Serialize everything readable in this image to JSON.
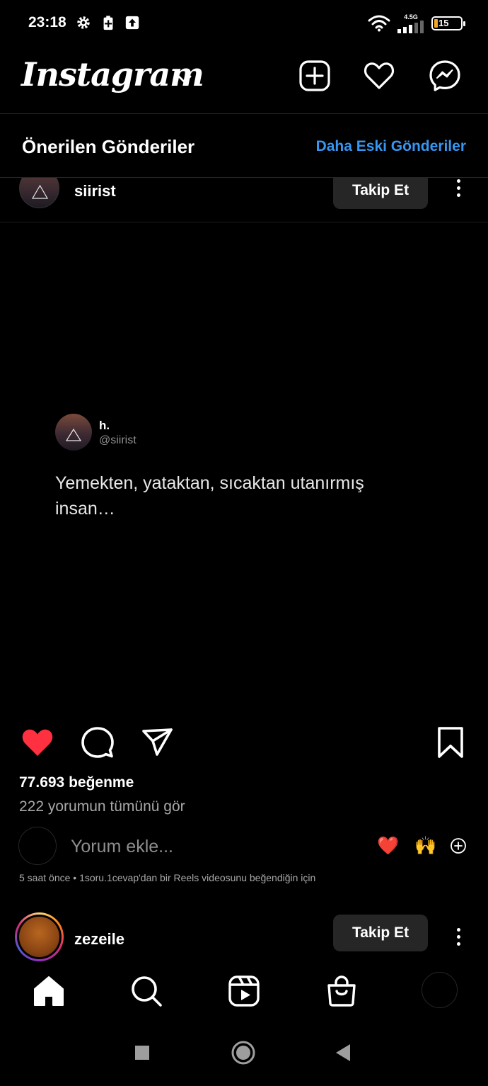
{
  "status_bar": {
    "time": "23:18",
    "network_type": "4.5G",
    "battery_level": "15",
    "battery_color": "#f5a623",
    "icons": [
      "settings-icon",
      "battery-saver-icon",
      "upload-icon",
      "wifi-icon",
      "signal-icon",
      "battery-icon"
    ]
  },
  "header": {
    "logo": "Instagram",
    "icons": [
      "chevron-down-icon",
      "create-post-icon",
      "activity-heart-icon",
      "messenger-icon"
    ]
  },
  "suggested": {
    "title": "Önerilen Gönderiler",
    "older_posts_link": "Daha Eski Gönderiler",
    "link_color": "#3797f0"
  },
  "post": {
    "username": "siirist",
    "follow_label": "Takip Et",
    "tweet_name": "h.",
    "tweet_handle": "@siirist",
    "tweet_text": "Yemekten, yataktan, sıcaktan utanırmış insan…",
    "liked": true,
    "like_color": "#ff3040",
    "likes": "77.693 beğenme",
    "view_comments": "222 yorumun tümünü gör",
    "comment_placeholder": "Yorum ekle...",
    "quick_emojis": [
      "❤️",
      "🙌"
    ],
    "meta": "5 saat önce • 1soru.1cevap'dan bir Reels videosunu beğendiğin için"
  },
  "next_post": {
    "username": "zezeile",
    "follow_label": "Takip Et"
  },
  "bottom_nav": {
    "items": [
      "home-icon",
      "search-icon",
      "reels-icon",
      "shop-icon",
      "profile-avatar"
    ],
    "active": "home-icon"
  },
  "system_nav": {
    "items": [
      "recents-button",
      "home-button",
      "back-button"
    ]
  }
}
